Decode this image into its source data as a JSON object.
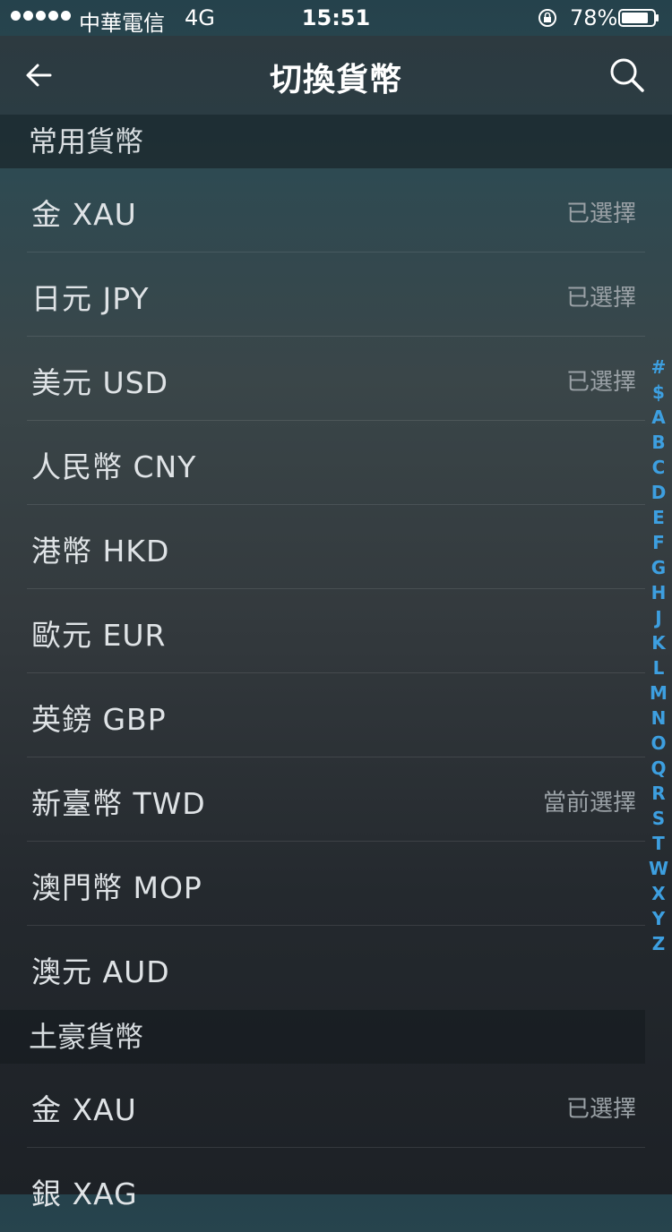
{
  "status_bar": {
    "carrier": "中華電信",
    "network": "4G",
    "time": "15:51",
    "battery": "78%"
  },
  "nav": {
    "title": "切換貨幣"
  },
  "sections": [
    {
      "title": "常用貨幣",
      "rows": [
        {
          "name": "金 XAU",
          "tag": "已選擇"
        },
        {
          "name": "日元 JPY",
          "tag": "已選擇"
        },
        {
          "name": "美元 USD",
          "tag": "已選擇"
        },
        {
          "name": "人民幣 CNY",
          "tag": ""
        },
        {
          "name": "港幣 HKD",
          "tag": ""
        },
        {
          "name": "歐元 EUR",
          "tag": ""
        },
        {
          "name": "英鎊 GBP",
          "tag": ""
        },
        {
          "name": "新臺幣 TWD",
          "tag": "當前選擇"
        },
        {
          "name": "澳門幣 MOP",
          "tag": ""
        },
        {
          "name": "澳元 AUD",
          "tag": ""
        }
      ]
    },
    {
      "title": "土豪貨幣",
      "rows": [
        {
          "name": "金 XAU",
          "tag": "已選擇"
        },
        {
          "name": "銀 XAG",
          "tag": ""
        }
      ]
    }
  ],
  "index_letters": [
    "#",
    "$",
    "A",
    "B",
    "C",
    "D",
    "E",
    "F",
    "G",
    "H",
    "J",
    "K",
    "L",
    "M",
    "N",
    "O",
    "Q",
    "R",
    "S",
    "T",
    "W",
    "X",
    "Y",
    "Z"
  ],
  "colors": {
    "accent": "#3d9fe0",
    "tag_text": "#9aa1a6"
  }
}
